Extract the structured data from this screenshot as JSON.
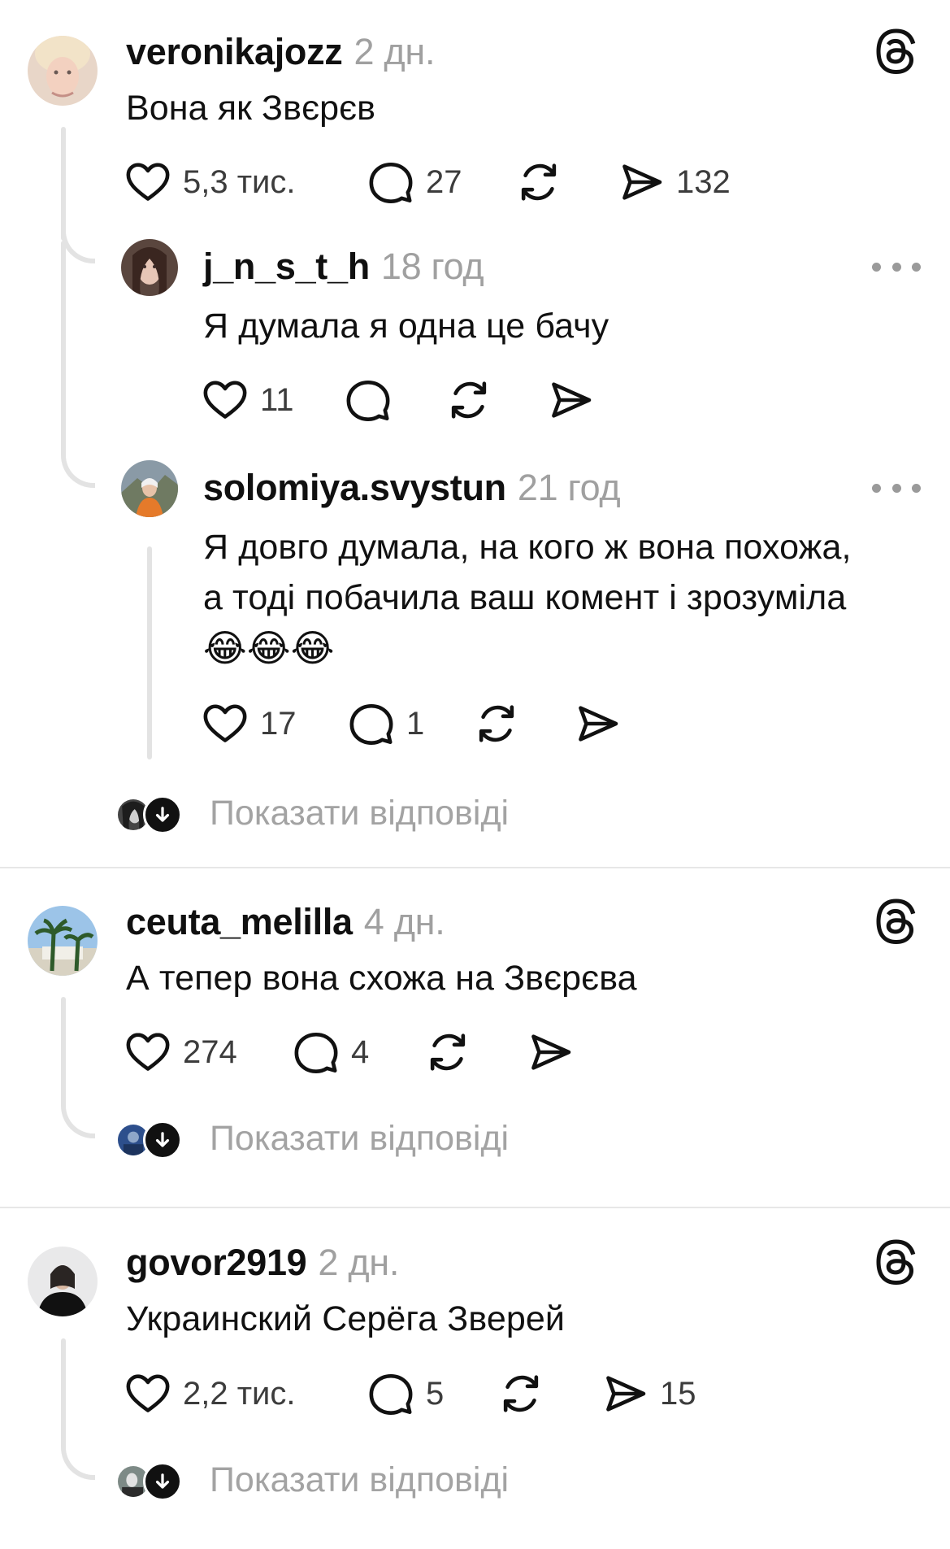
{
  "threads": [
    {
      "username": "veronikajozz",
      "time": "2 дн.",
      "text": "Вона як Звєрєв",
      "likes": "5,3 тис.",
      "replies": "27",
      "shares": "132",
      "icon": "threads-icon",
      "nested": [
        {
          "username": "j_n_s_t_h",
          "time": "18 год",
          "text": "Я думала я одна це бачу",
          "likes": "11",
          "replies": "",
          "shares": "",
          "icon": "more-icon"
        },
        {
          "username": "solomiya.svystun",
          "time": "21 год",
          "text_lines": [
            "Я довго думала, на кого ж вона похожа,",
            "а тоді побачила ваш комент і зрозуміла",
            "😂😂😂"
          ],
          "likes": "17",
          "replies": "1",
          "shares": "",
          "icon": "more-icon"
        }
      ],
      "show_replies": "Показати відповіді"
    },
    {
      "username": "ceuta_melilla",
      "time": "4 дн.",
      "text": "А тепер вона схожа на Звєрєва",
      "likes": "274",
      "replies": "4",
      "shares": "",
      "icon": "threads-icon",
      "show_replies": "Показати відповіді"
    },
    {
      "username": "govor2919",
      "time": "2 дн.",
      "text": "Украинский Серёга Зверей",
      "likes": "2,2 тис.",
      "replies": "5",
      "shares": "15",
      "icon": "threads-icon",
      "show_replies": "Показати відповіді"
    }
  ],
  "colors": {
    "text": "#111111",
    "muted": "#a0a0a0",
    "line": "#e3e3e3",
    "background": "#ffffff"
  }
}
